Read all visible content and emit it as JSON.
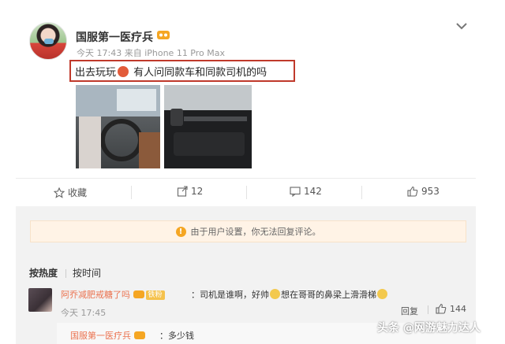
{
  "post": {
    "username": "国服第一医疗兵",
    "meta": "今天 17:43 来自 iPhone 11 Pro Max",
    "text_before_emoji": "出去玩玩",
    "text_after_emoji": " 有人问同款车和同款司机的吗"
  },
  "actions": {
    "favorite_label": "收藏",
    "share_count": "12",
    "comment_count": "142",
    "like_count": "953"
  },
  "notice": {
    "text": "由于用户设置，你无法回复评论。"
  },
  "sort": {
    "by_hot": "按热度",
    "by_time": "按时间"
  },
  "comment": {
    "username": "阿乔减肥戒糖了吗",
    "fan_badge": "铁粉",
    "text_part1": "：司机是谁啊，好帅",
    "text_part2": "想在哥哥的鼻梁上滑滑梯",
    "time": "今天 17:45",
    "reply_label": "回复",
    "like_count": "144"
  },
  "sub_reply": {
    "username": "国服第一医疗兵",
    "text": "：多少钱"
  },
  "watermark": {
    "text": "头条 @网游魅力达人"
  },
  "colors": {
    "highlight_border": "#c0392b",
    "username_link": "#eb7350",
    "notice_bg": "#fff3e6",
    "notice_icon": "#f5a623"
  }
}
